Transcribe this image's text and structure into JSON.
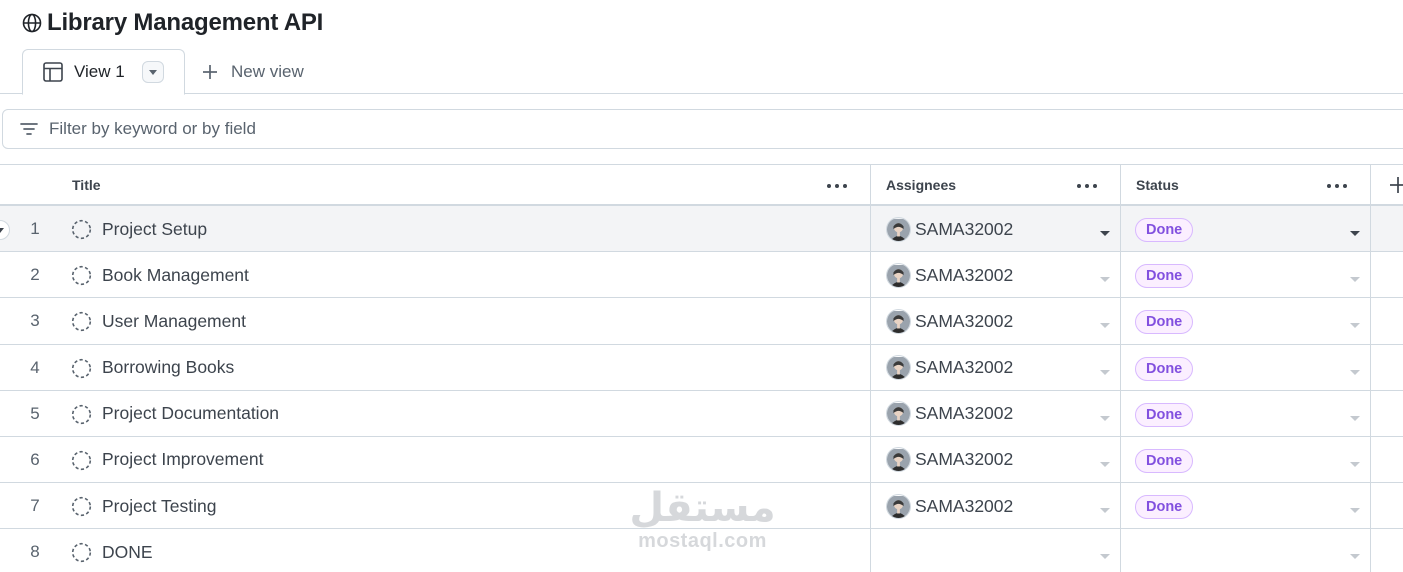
{
  "project": {
    "title": "Library Management API",
    "icon": "globe-icon"
  },
  "tabs": {
    "active": {
      "label": "View 1",
      "icon": "table-icon"
    },
    "new_view_label": "New view"
  },
  "filter": {
    "placeholder": "Filter by keyword or by field"
  },
  "columns": {
    "title": "Title",
    "assignees": "Assignees",
    "status": "Status"
  },
  "rows": [
    {
      "num": "1",
      "title": "Project Setup",
      "assignee": "SAMA32002",
      "status": "Done"
    },
    {
      "num": "2",
      "title": "Book Management",
      "assignee": "SAMA32002",
      "status": "Done"
    },
    {
      "num": "3",
      "title": "User Management",
      "assignee": "SAMA32002",
      "status": "Done"
    },
    {
      "num": "4",
      "title": "Borrowing Books",
      "assignee": "SAMA32002",
      "status": "Done"
    },
    {
      "num": "5",
      "title": "Project Documentation",
      "assignee": "SAMA32002",
      "status": "Done"
    },
    {
      "num": "6",
      "title": "Project Improvement",
      "assignee": "SAMA32002",
      "status": "Done"
    },
    {
      "num": "7",
      "title": "Project Testing",
      "assignee": "SAMA32002",
      "status": "Done"
    },
    {
      "num": "8",
      "title": "DONE",
      "assignee": "",
      "status": ""
    }
  ],
  "watermark": {
    "arabic": "مستقل",
    "latin": "mostaql.com"
  },
  "colors": {
    "status_done_text": "#8250df",
    "status_done_bg": "#fbefff",
    "status_done_border": "#d8b9ff",
    "border": "#d1d9e0"
  }
}
